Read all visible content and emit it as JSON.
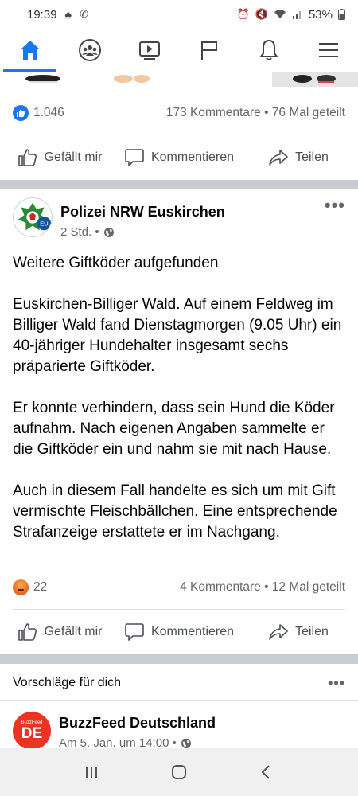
{
  "status_bar": {
    "time": "19:39",
    "battery": "53%"
  },
  "nav": {
    "items": [
      {
        "name": "home",
        "icon": "home-icon"
      },
      {
        "name": "groups",
        "icon": "groups-icon"
      },
      {
        "name": "watch",
        "icon": "video-icon"
      },
      {
        "name": "pages",
        "icon": "flag-icon"
      },
      {
        "name": "notifications",
        "icon": "bell-icon"
      },
      {
        "name": "menu",
        "icon": "menu-icon"
      }
    ],
    "active": "home",
    "accent": "#1877f2"
  },
  "prev_post": {
    "likes": "1.046",
    "comments_shares": "173 Kommentare • 76 Mal geteilt"
  },
  "actions": {
    "like": "Gefällt mir",
    "comment": "Kommentieren",
    "share": "Teilen"
  },
  "post": {
    "page_name": "Polizei NRW Euskirchen",
    "time": "2 Std. •",
    "paragraphs": [
      "Weitere Giftköder aufgefunden",
      "Euskirchen-Billiger Wald. Auf einem Feldweg im Billiger Wald fand Dienstagmorgen (9.05 Uhr) ein 40-jähriger Hundehalter insgesamt sechs präparierte Giftköder.",
      "Er konnte verhindern, dass sein Hund die Köder aufnahm. Nach eigenen Angaben sammelte er die Giftköder ein und nahm sie mit nach Hause.",
      "Auch in diesem Fall handelte es sich um mit Gift vermischte Fleischbällchen. Eine entsprechende Strafanzeige erstattete er im Nachgang."
    ],
    "reactions": "22",
    "comments_shares": "4 Kommentare • 12 Mal geteilt"
  },
  "suggestions": {
    "header": "Vorschläge für dich",
    "page_name": "BuzzFeed Deutschland",
    "time": "Am 5. Jan. um 14:00 •",
    "avatar_small": "BuzzFeed",
    "avatar_big": "DE"
  }
}
